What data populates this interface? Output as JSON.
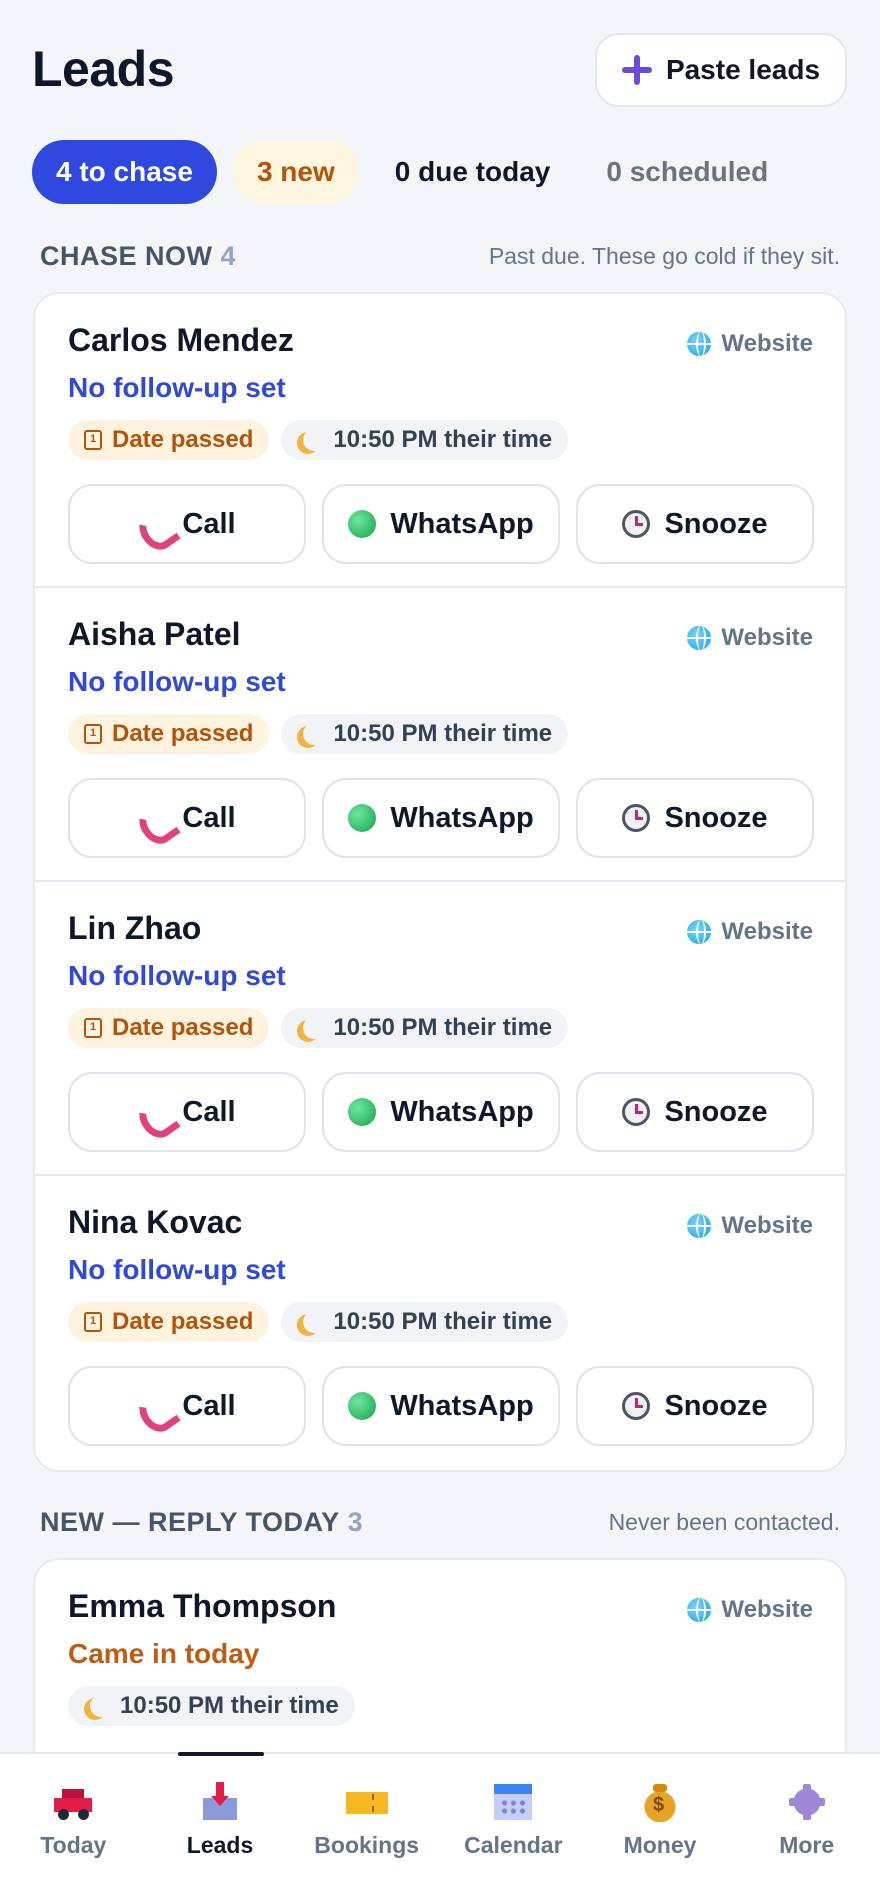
{
  "header": {
    "title": "Leads",
    "paste_button": "Paste leads"
  },
  "filters": [
    {
      "label": "4 to chase",
      "state": "active"
    },
    {
      "label": "3 new",
      "state": "new"
    },
    {
      "label": "0 due today",
      "state": "plain"
    },
    {
      "label": "0 scheduled",
      "state": "muted"
    }
  ],
  "chase_section": {
    "title": "CHASE NOW",
    "count": "4",
    "note": "Past due. These go cold if they sit."
  },
  "chase_leads": [
    {
      "name": "Carlos Mendez",
      "source": "Website",
      "followup": "No follow-up set",
      "status_tag": "Date passed",
      "time_tag": "10:50 PM their time"
    },
    {
      "name": "Aisha Patel",
      "source": "Website",
      "followup": "No follow-up set",
      "status_tag": "Date passed",
      "time_tag": "10:50 PM their time"
    },
    {
      "name": "Lin Zhao",
      "source": "Website",
      "followup": "No follow-up set",
      "status_tag": "Date passed",
      "time_tag": "10:50 PM their time"
    },
    {
      "name": "Nina Kovac",
      "source": "Website",
      "followup": "No follow-up set",
      "status_tag": "Date passed",
      "time_tag": "10:50 PM their time"
    }
  ],
  "actions": {
    "call": "Call",
    "whatsapp": "WhatsApp",
    "snooze": "Snooze"
  },
  "new_section": {
    "title": "NEW — REPLY TODAY",
    "count": "3",
    "note": "Never been contacted."
  },
  "new_leads": [
    {
      "name": "Emma Thompson",
      "source": "Website",
      "followup": "Came in today",
      "time_tag": "10:50 PM their time"
    }
  ],
  "bottom_nav": [
    {
      "label": "Today",
      "icon": "car-icon"
    },
    {
      "label": "Leads",
      "icon": "inbox-tray-icon",
      "active": true
    },
    {
      "label": "Bookings",
      "icon": "ticket-icon"
    },
    {
      "label": "Calendar",
      "icon": "calendar-icon"
    },
    {
      "label": "Money",
      "icon": "money-bag-icon"
    },
    {
      "label": "More",
      "icon": "gear-icon"
    }
  ],
  "colors": {
    "accent": "#2f49e0",
    "followup_blue": "#3149d9",
    "warning": "#b45309",
    "background": "#f3f5f9"
  }
}
